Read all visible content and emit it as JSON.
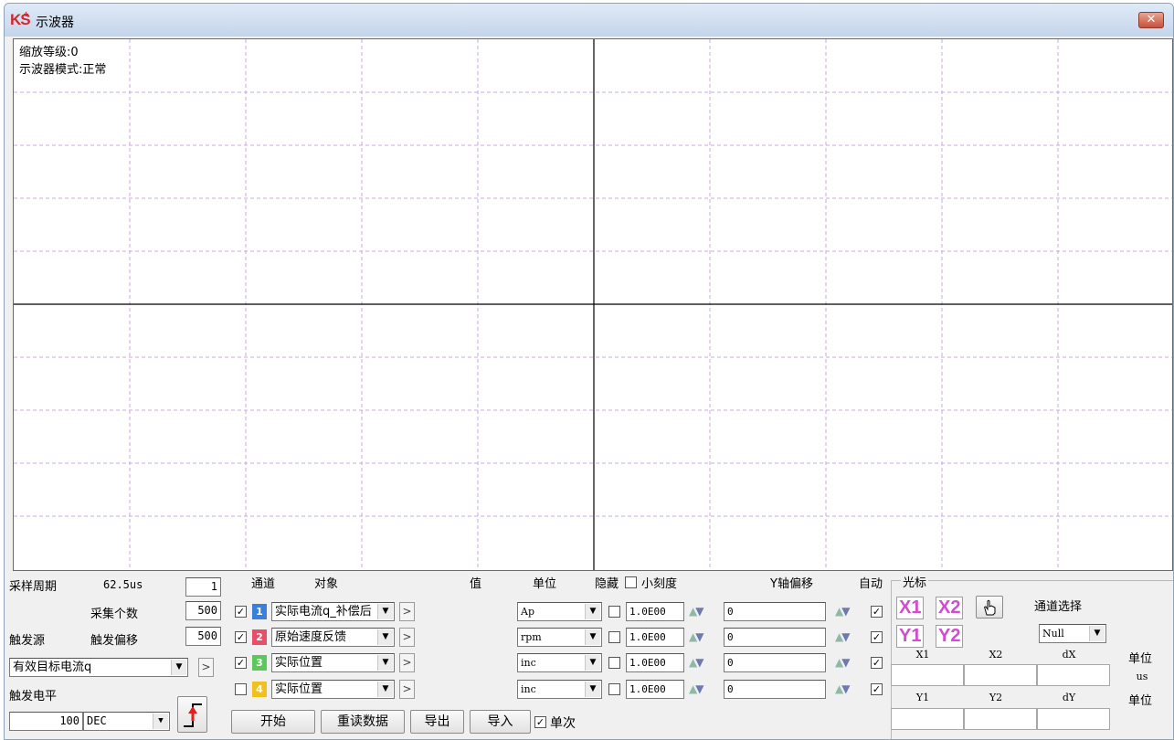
{
  "window": {
    "title": "示波器",
    "logo": "KS",
    "logo_sup": "+",
    "close_label": "✕"
  },
  "scope": {
    "zoom_text": "缩放等级:0",
    "mode_text": "示波器模式:正常"
  },
  "left": {
    "sample_period_label": "采样周期",
    "sample_period_value": "62.5us",
    "sample_period_input": "1",
    "sample_count_label": "采集个数",
    "sample_count_value": "500",
    "trigger_source_label": "触发源",
    "trigger_offset_label": "触发偏移",
    "trigger_offset_value": "500",
    "trigger_source_value": "有效目标电流q",
    "trigger_source_btn": ">",
    "trigger_level_label": "触发电平",
    "trigger_level_value": "100",
    "format_value": "DEC",
    "edge_icon": "rising-edge-icon"
  },
  "headers": {
    "channel": "通道",
    "object": "对象",
    "value": "值",
    "unit": "单位",
    "hide": "隐藏",
    "fine": "小刻度",
    "offset": "Y轴偏移",
    "auto": "自动"
  },
  "channels": [
    {
      "checked": "✓",
      "num": "1",
      "color": "#3a7fd8",
      "object": "实际电流q_补偿后",
      "btn": ">",
      "value": "",
      "unit": "Ap",
      "hide": "",
      "scale": "1.0E00",
      "offset": "0",
      "auto": "✓"
    },
    {
      "checked": "✓",
      "num": "2",
      "color": "#e8506a",
      "object": "原始速度反馈",
      "btn": ">",
      "value": "",
      "unit": "rpm",
      "hide": "",
      "scale": "1.0E00",
      "offset": "0",
      "auto": "✓"
    },
    {
      "checked": "✓",
      "num": "3",
      "color": "#5cc85c",
      "object": "实际位置",
      "btn": ">",
      "value": "",
      "unit": "inc",
      "hide": "",
      "scale": "1.0E00",
      "offset": "0",
      "auto": "✓"
    },
    {
      "checked": "",
      "num": "4",
      "color": "#f0c020",
      "object": "实际位置",
      "btn": ">",
      "value": "",
      "unit": "inc",
      "hide": "",
      "scale": "1.0E00",
      "offset": "0",
      "auto": "✓"
    }
  ],
  "fine_checked": "",
  "bottom": {
    "start": "开始",
    "reread": "重读数据",
    "export": "导出",
    "import": "导入",
    "single_checked": "✓",
    "single_label": "单次"
  },
  "cursor": {
    "group_label": "光标",
    "x1": "X1",
    "x2": "X2",
    "y1": "Y1",
    "y2": "Y2",
    "hand_icon": "hand-pointer-icon",
    "channel_select_label": "通道选择",
    "channel_select_value": "Null",
    "col_x1": "X1",
    "col_x2": "X2",
    "col_dx": "dX",
    "unit_label_1": "单位",
    "unit_value_1": "us",
    "col_y1": "Y1",
    "col_y2": "Y2",
    "col_dy": "dY",
    "unit_label_2": "单位",
    "x1_val": "",
    "x2_val": "",
    "dx_val": "",
    "y1_val": "",
    "y2_val": "",
    "dy_val": ""
  }
}
